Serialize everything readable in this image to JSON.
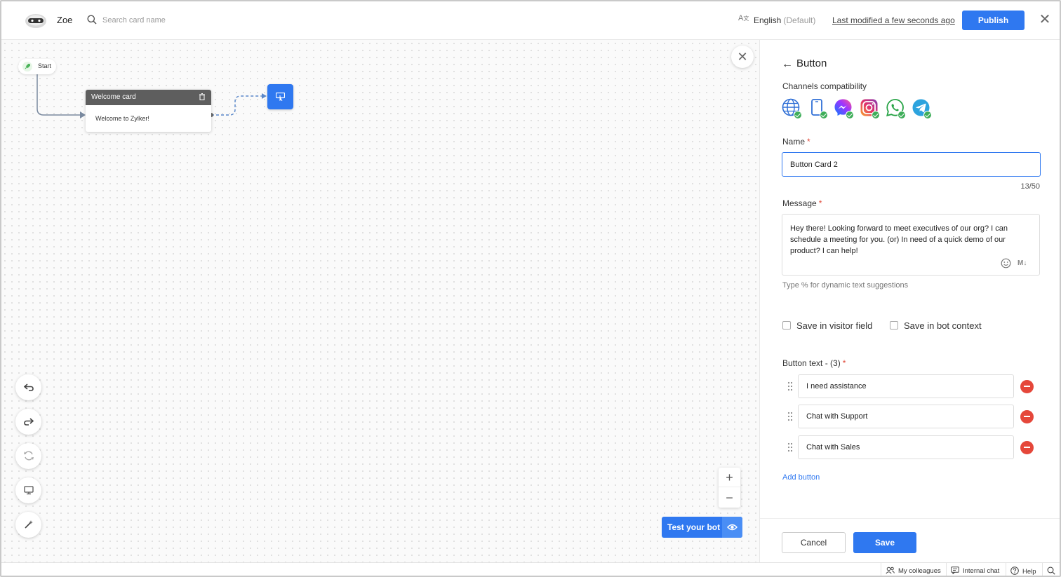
{
  "header": {
    "bot_name": "Zoe",
    "search_placeholder": "Search card name",
    "language": "English",
    "language_default": "(Default)",
    "last_modified": "Last modified a few seconds ago",
    "publish_label": "Publish"
  },
  "canvas": {
    "start_label": "Start",
    "welcome_card": {
      "title": "Welcome card",
      "message": "Welcome to Zylker!"
    },
    "test_bot_label": "Test your bot",
    "zoom_in": "+",
    "zoom_out": "−"
  },
  "panel": {
    "title": "Button",
    "channels_label": "Channels compatibility",
    "channels": [
      "web-globe-icon",
      "mobile-icon",
      "messenger-icon",
      "instagram-icon",
      "whatsapp-icon",
      "telegram-icon"
    ],
    "name_label": "Name",
    "name_value": "Button Card 2",
    "char_count": "13/50",
    "message_label": "Message",
    "message_value": "Hey there! Looking forward to meet executives of our org? I can schedule a meeting for you. (or) In need of a quick demo of our product? I can help!",
    "markdown_label": "M↓",
    "hint": "Type % for dynamic text suggestions",
    "save_visitor_field": "Save in visitor field",
    "save_bot_context": "Save in bot context",
    "button_text_label": "Button text - (3)",
    "buttons": [
      {
        "text": "I need assistance"
      },
      {
        "text": "Chat with Support"
      },
      {
        "text": "Chat with Sales"
      }
    ],
    "add_button_label": "Add button",
    "cancel_label": "Cancel",
    "save_label": "Save"
  },
  "bottom_bar": {
    "colleagues": "My colleagues",
    "internal_chat": "Internal chat",
    "help": "Help"
  },
  "colors": {
    "accent": "#2f78f0",
    "danger": "#e5473a",
    "success": "#3fae5a"
  }
}
